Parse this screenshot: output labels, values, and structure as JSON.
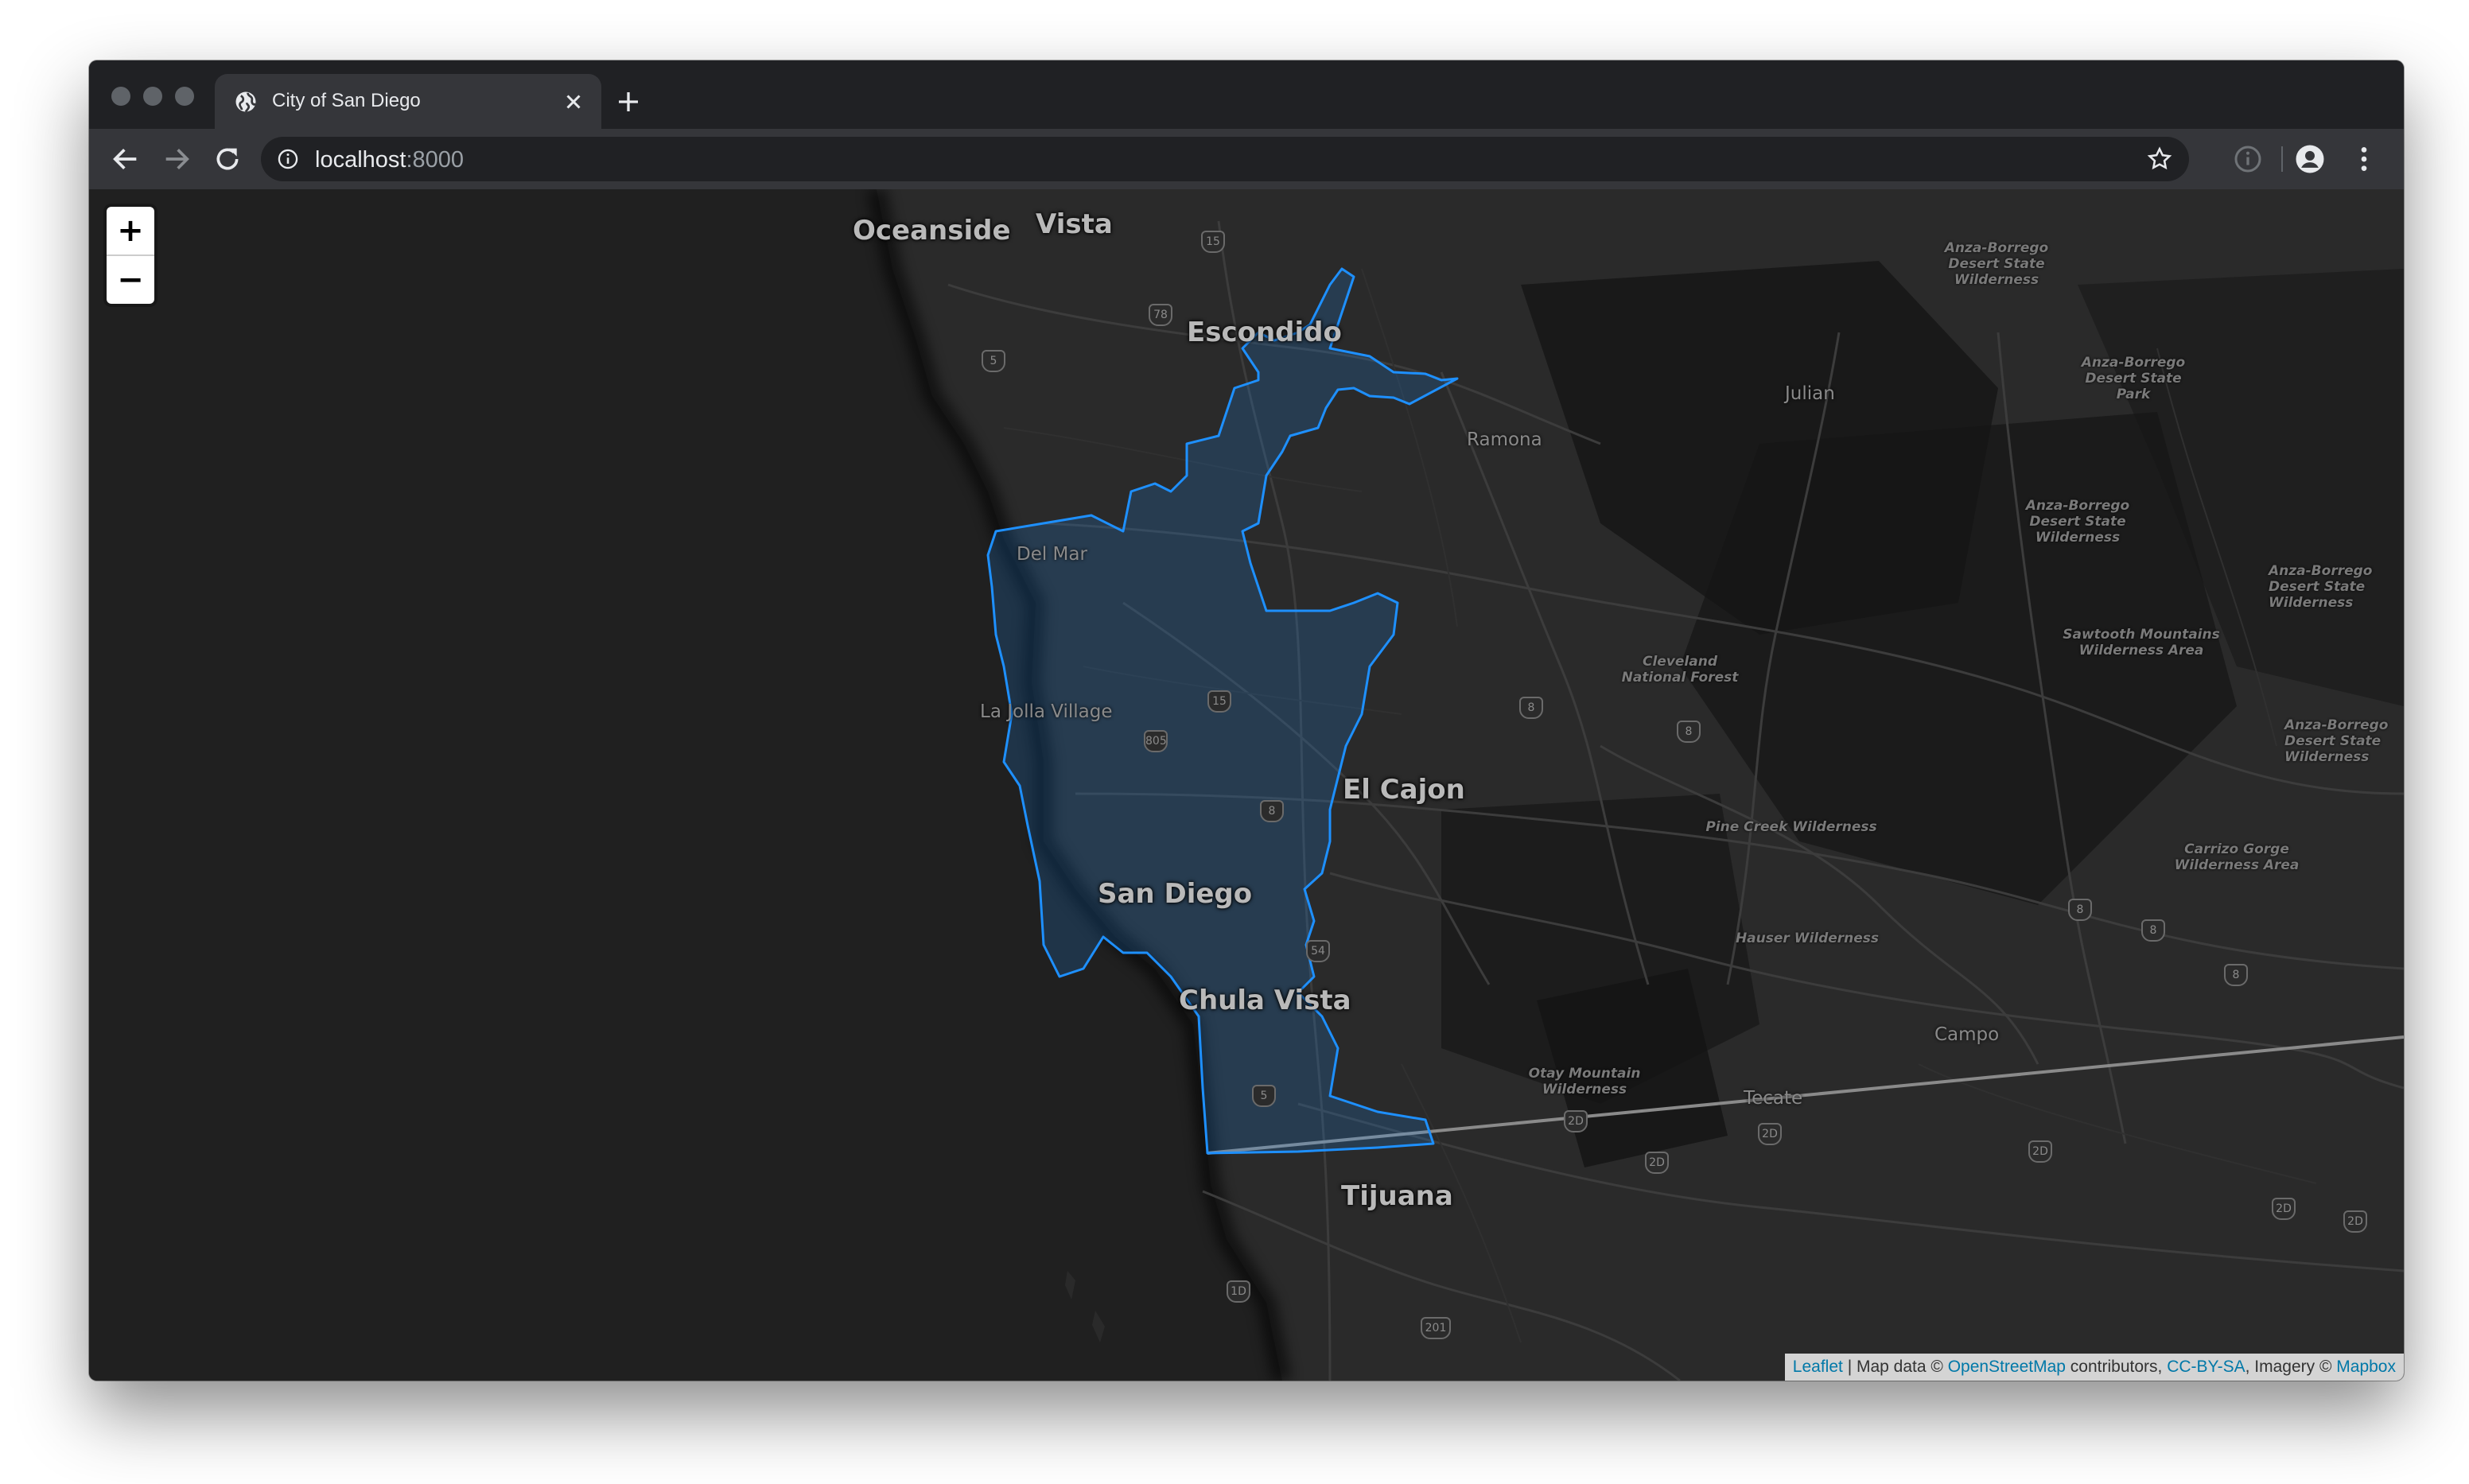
{
  "browser": {
    "tab": {
      "title": "City of San Diego",
      "favicon": "globe-icon"
    },
    "address_bar": {
      "host": "localhost",
      "port": ":8000"
    },
    "icons": [
      "back-arrow-icon",
      "forward-arrow-icon",
      "reload-icon",
      "info-icon",
      "star-icon",
      "extension-info-icon",
      "account-icon",
      "menu-dots-icon"
    ]
  },
  "map": {
    "zoom_in_label": "+",
    "zoom_out_label": "−",
    "boundary_color": "#1e90ff",
    "city_labels": {
      "oceanside": "Oceanside",
      "vista": "Vista",
      "escondido": "Escondido",
      "el_cajon": "El Cajon",
      "san_diego": "San Diego",
      "chula_vista": "Chula Vista",
      "tijuana": "Tijuana"
    },
    "town_labels": {
      "ramona": "Ramona",
      "julian": "Julian",
      "del_mar": "Del Mar",
      "la_jolla": "La Jolla Village",
      "campo": "Campo",
      "tecate": "Tecate"
    },
    "park_labels": {
      "anza1": "Anza-Borrego Desert State Wilderness",
      "anza2": "Anza-Borrego Desert State Park",
      "anza3": "Anza-Borrego Desert State Wilderness",
      "anza4": "Anza-Borrego Desert State Wilderness",
      "anza5": "Anza-Borrego Desert State Wilderness",
      "sawtooth": "Sawtooth Mountains Wilderness Area",
      "cleveland": "Cleveland National Forest",
      "pine_creek": "Pine Creek Wilderness",
      "hauser": "Hauser Wilderness",
      "carrizo": "Carrizo Gorge Wilderness Area",
      "otay": "Otay Mountain Wilderness"
    },
    "shields": {
      "s15a": "15",
      "s78": "78",
      "s5a": "5",
      "s15b": "15",
      "s805": "805",
      "s8a": "8",
      "s8b": "8",
      "s8c": "8",
      "s54": "54",
      "s5b": "5",
      "s8d": "8",
      "s8e": "8",
      "s8f": "8",
      "s2da": "2D",
      "s2db": "2D",
      "s2dc": "2D",
      "s2dd": "2D",
      "s2de": "2D",
      "s2df": "2D",
      "s1d": "1D",
      "s201": "201"
    }
  },
  "attribution": {
    "leaflet": "Leaflet",
    "sep": " | Map data © ",
    "osm": "OpenStreetMap",
    "contributors": " contributors, ",
    "ccbysa": "CC-BY-SA",
    "imagery": ", Imagery © ",
    "mapbox": "Mapbox"
  }
}
